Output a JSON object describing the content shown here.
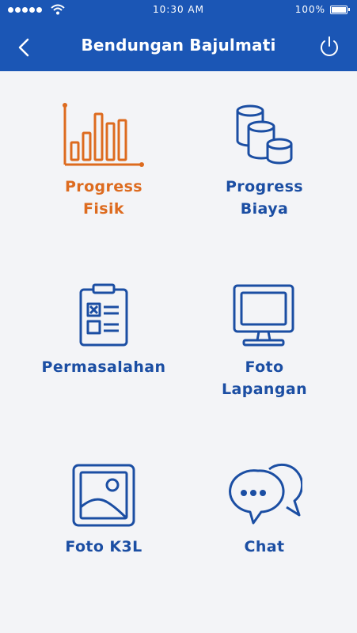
{
  "status_bar": {
    "time": "10:30 AM",
    "battery": "100%"
  },
  "header": {
    "title": "Bendungan Bajulmati",
    "back_icon": "chevron-left-icon",
    "power_icon": "power-icon"
  },
  "colors": {
    "header_bg": "#1b56b5",
    "active": "#dd6b1f",
    "primary": "#1b4ea3",
    "page_bg": "#f3f4f7"
  },
  "menu": [
    {
      "label": "Progress\nFisik",
      "icon": "bar-chart-icon",
      "active": true
    },
    {
      "label": "Progress\nBiaya",
      "icon": "coins-icon",
      "active": false
    },
    {
      "label": "Permasalahan",
      "icon": "clipboard-icon",
      "active": false
    },
    {
      "label": "Foto\nLapangan",
      "icon": "monitor-icon",
      "active": false
    },
    {
      "label": "Foto K3L",
      "icon": "picture-icon",
      "active": false
    },
    {
      "label": "Chat",
      "icon": "chat-bubbles-icon",
      "active": false
    }
  ]
}
